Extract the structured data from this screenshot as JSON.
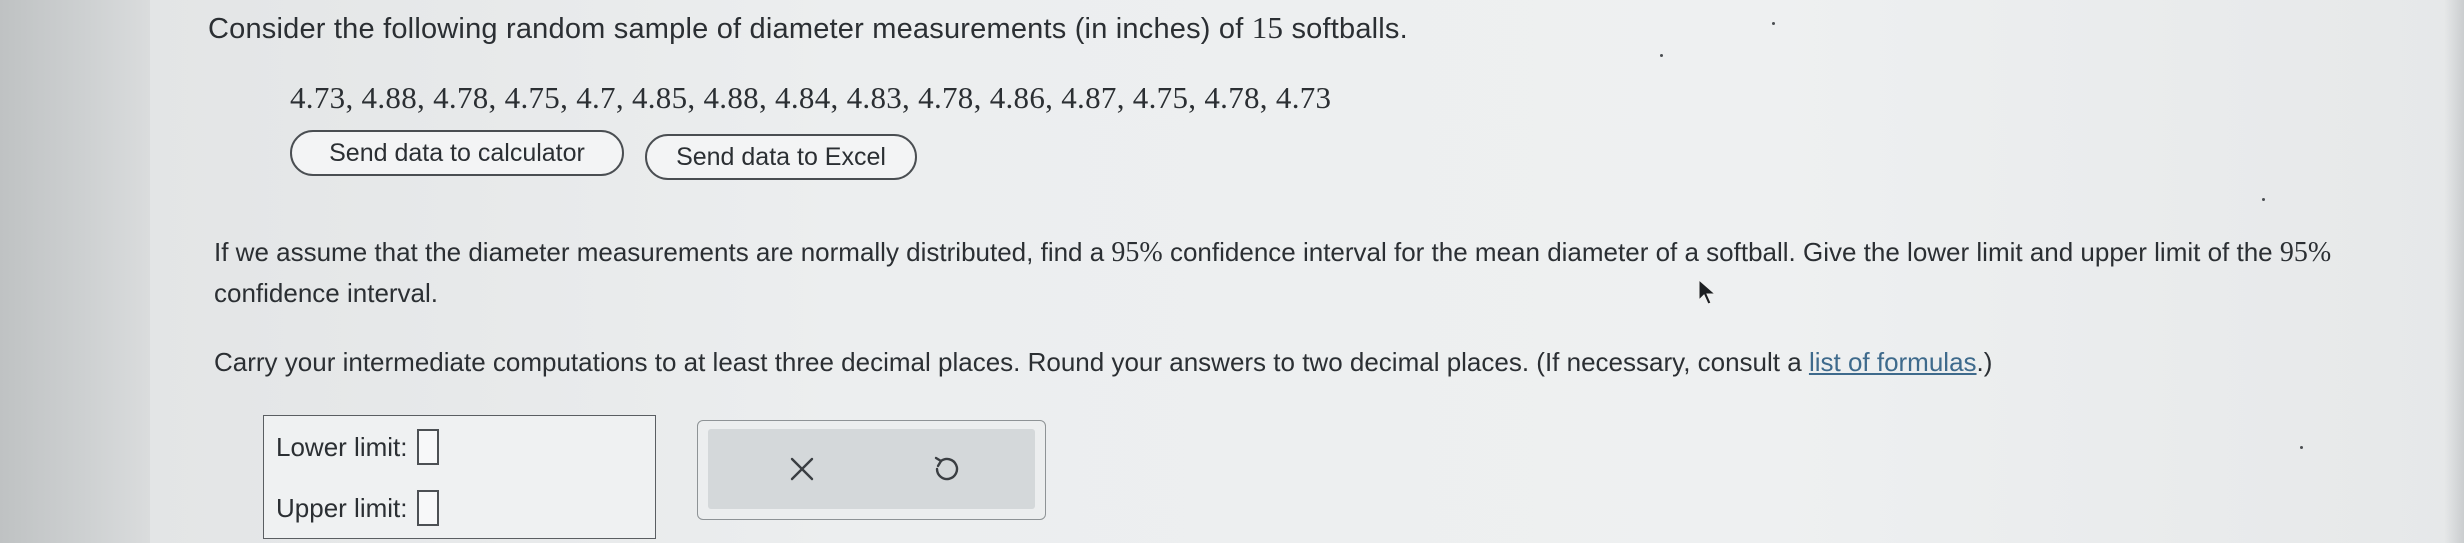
{
  "intro": {
    "before": "Consider the following random sample of diameter measurements (in inches) of ",
    "n": "15",
    "after": " softballs."
  },
  "dataset": "4.73, 4.88, 4.78, 4.75, 4.7, 4.85, 4.88, 4.84, 4.83, 4.78, 4.86, 4.87, 4.75, 4.78, 4.73",
  "buttons": {
    "send_calculator": "Send data to calculator",
    "send_excel": "Send data to Excel"
  },
  "question": {
    "part1": "If we assume that the diameter measurements are normally distributed, find a ",
    "pct1": "95%",
    "part2": " confidence interval for the mean diameter of a softball. Give the lower limit and upper limit of the ",
    "pct2": "95%",
    "part3": " confidence interval."
  },
  "instructions": {
    "text": "Carry your intermediate computations to at least three decimal places. Round your answers to two decimal places. (If necessary, consult a ",
    "link": "list of formulas",
    "end": ".)"
  },
  "answers": {
    "lower_label": "Lower limit:",
    "lower_value": "",
    "upper_label": "Upper limit:",
    "upper_value": ""
  },
  "toolbar": {
    "clear_icon": "x-icon",
    "undo_icon": "undo-icon"
  },
  "colors": {
    "link": "#3e6a8c",
    "text": "#2b2f33",
    "tool_bg": "#d4d8da"
  }
}
